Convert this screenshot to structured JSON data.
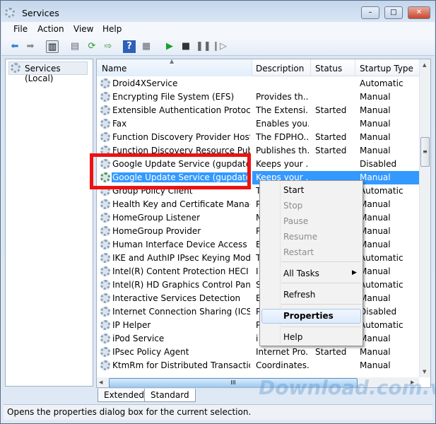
{
  "window": {
    "title": "Services",
    "min": "–",
    "max": "□",
    "close": "✕"
  },
  "menu": [
    "File",
    "Action",
    "View",
    "Help"
  ],
  "tree": {
    "root": "Services (Local)"
  },
  "columns": {
    "name": "Name",
    "description": "Description",
    "status": "Status",
    "startup": "Startup Type"
  },
  "rows": [
    {
      "name": "Droid4XService",
      "description": "",
      "status": "",
      "startup": "Automatic"
    },
    {
      "name": "Encrypting File System (EFS)",
      "description": "Provides th...",
      "status": "",
      "startup": "Manual"
    },
    {
      "name": "Extensible Authentication Protocol",
      "description": "The Extensi...",
      "status": "Started",
      "startup": "Manual"
    },
    {
      "name": "Fax",
      "description": "Enables you...",
      "status": "",
      "startup": "Manual"
    },
    {
      "name": "Function Discovery Provider Host",
      "description": "The FDPHO...",
      "status": "Started",
      "startup": "Manual"
    },
    {
      "name": "Function Discovery Resource Publi...",
      "description": "Publishes th...",
      "status": "Started",
      "startup": "Manual"
    },
    {
      "name": "Google Update Service (gupdate)",
      "description": "Keeps your ...",
      "status": "",
      "startup": "Disabled"
    },
    {
      "name": "Google Update Service (gupdatem)",
      "description": "Keeps your ...",
      "status": "",
      "startup": "Manual"
    },
    {
      "name": "Group Policy Client",
      "description": "T",
      "status": "",
      "startup": "Automatic"
    },
    {
      "name": "Health Key and Certificate Manage...",
      "description": "P",
      "status": "",
      "startup": "Manual"
    },
    {
      "name": "HomeGroup Listener",
      "description": "M",
      "status": "",
      "startup": "Manual"
    },
    {
      "name": "HomeGroup Provider",
      "description": "P",
      "status": "",
      "startup": "Manual"
    },
    {
      "name": "Human Interface Device Access",
      "description": "E",
      "status": "",
      "startup": "Manual"
    },
    {
      "name": "IKE and AuthIP IPsec Keying Modul...",
      "description": "T",
      "status": "",
      "startup": "Automatic"
    },
    {
      "name": "Intel(R) Content Protection HECI Se...",
      "description": "I",
      "status": "",
      "startup": "Manual"
    },
    {
      "name": "Intel(R) HD Graphics Control Panel ...",
      "description": "S",
      "status": "",
      "startup": "Automatic"
    },
    {
      "name": "Interactive Services Detection",
      "description": "E",
      "status": "",
      "startup": "Manual"
    },
    {
      "name": "Internet Connection Sharing (ICS)",
      "description": "P",
      "status": "",
      "startup": "Disabled"
    },
    {
      "name": "IP Helper",
      "description": "P",
      "status": "",
      "startup": "Automatic"
    },
    {
      "name": "iPod Service",
      "description": "i",
      "status": "",
      "startup": "Manual"
    },
    {
      "name": "IPsec Policy Agent",
      "description": "Internet Pro...",
      "status": "Started",
      "startup": "Manual"
    },
    {
      "name": "KtmRm for Distributed Transaction...",
      "description": "Coordinates...",
      "status": "",
      "startup": "Manual"
    }
  ],
  "tabs": [
    "Extended",
    "Standard"
  ],
  "context_menu": {
    "start": "Start",
    "stop": "Stop",
    "pause": "Pause",
    "resume": "Resume",
    "restart": "Restart",
    "all_tasks": "All Tasks",
    "refresh": "Refresh",
    "properties": "Properties",
    "help": "Help"
  },
  "status_bar": "Opens the properties dialog box for the current selection.",
  "watermark": "Download.com.vn"
}
